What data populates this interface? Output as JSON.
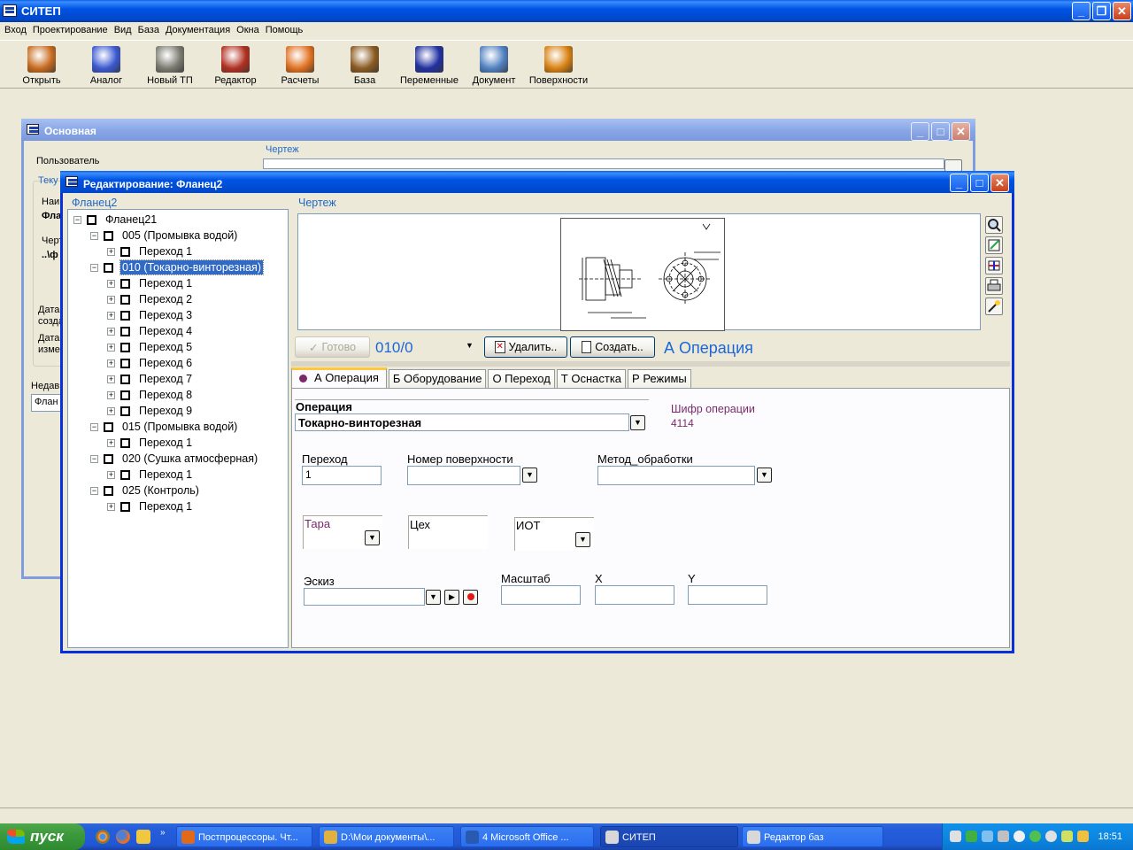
{
  "app": {
    "title": "СИТЕП",
    "menu": [
      "Вход",
      "Проектирование",
      "Вид",
      "База",
      "Документация",
      "Окна",
      "Помощь"
    ],
    "toolbar": [
      {
        "label": "Открыть",
        "icon": "open-folder-icon",
        "color": "#c86a1e"
      },
      {
        "label": "Аналог",
        "icon": "analog-gears-icon",
        "color": "#3a58d0"
      },
      {
        "label": "Новый ТП",
        "icon": "compass-icon",
        "color": "#7a7a70"
      },
      {
        "label": "Редактор",
        "icon": "editor-pencil-icon",
        "color": "#b03020"
      },
      {
        "label": "Расчеты",
        "icon": "calculator-icon",
        "color": "#e07020"
      },
      {
        "label": "База",
        "icon": "database-box-icon",
        "color": "#8a5a20"
      },
      {
        "label": "Переменные",
        "icon": "function-fx-icon",
        "color": "#2030a0"
      },
      {
        "label": "Документ",
        "icon": "document-icon",
        "color": "#5080c0"
      },
      {
        "label": "Поверхности",
        "icon": "surfaces-gear-icon",
        "color": "#d88010"
      }
    ]
  },
  "main_window": {
    "title": "Основная",
    "user_label": "Пользователь",
    "drawing_label": "Чертеж",
    "current_label": "Теку",
    "name_label": "Наим",
    "name_value": "Фла",
    "drawing_label2": "Черт",
    "drawing_value": "..\\ф",
    "created_label": "Дата созда",
    "modified_label": "Дата изме",
    "recent_label": "Недав",
    "recent_value": "Флан"
  },
  "edit_window": {
    "title": "Редактирование: Фланец2",
    "tree_group_label": "Фланец2",
    "drawing_group_label": "Чертеж",
    "tree": [
      {
        "label": "Фланец21",
        "level": 0,
        "expander": "−"
      },
      {
        "label": "005 (Промывка водой)",
        "level": 1,
        "expander": "−"
      },
      {
        "label": "Переход 1",
        "level": 2,
        "expander": "+"
      },
      {
        "label": "010 (Токарно-винторезная)",
        "level": 1,
        "expander": "−",
        "selected": true
      },
      {
        "label": "Переход 1",
        "level": 2,
        "expander": "+"
      },
      {
        "label": "Переход 2",
        "level": 2,
        "expander": "+"
      },
      {
        "label": "Переход 3",
        "level": 2,
        "expander": "+"
      },
      {
        "label": "Переход 4",
        "level": 2,
        "expander": "+"
      },
      {
        "label": "Переход 5",
        "level": 2,
        "expander": "+"
      },
      {
        "label": "Переход 6",
        "level": 2,
        "expander": "+"
      },
      {
        "label": "Переход 7",
        "level": 2,
        "expander": "+"
      },
      {
        "label": "Переход 8",
        "level": 2,
        "expander": "+"
      },
      {
        "label": "Переход 9",
        "level": 2,
        "expander": "+"
      },
      {
        "label": "015 (Промывка водой)",
        "level": 1,
        "expander": "−"
      },
      {
        "label": "Переход 1",
        "level": 2,
        "expander": "+"
      },
      {
        "label": "020 (Сушка атмосферная)",
        "level": 1,
        "expander": "−"
      },
      {
        "label": "Переход 1",
        "level": 2,
        "expander": "+"
      },
      {
        "label": "025 (Контроль)",
        "level": 1,
        "expander": "−"
      },
      {
        "label": "Переход 1",
        "level": 2,
        "expander": "+"
      }
    ],
    "ready_button": "Готово",
    "operation_code": "010/0",
    "delete_button": "Удалить..",
    "create_button": "Создать..",
    "section_title": "А Операция",
    "tabs": [
      "А Операция",
      "Б Оборудование",
      "О Переход",
      "Т Оснастка",
      "Р Режимы"
    ],
    "form": {
      "operation_label": "Операция",
      "operation_value": "Токарно-винторезная",
      "cipher_label": "Шифр операции",
      "cipher_value": "4114",
      "transition_label": "Переход",
      "transition_value": "1",
      "surface_label": "Номер поверхности",
      "surface_value": "",
      "method_label": "Метод_обработки",
      "method_value": "",
      "tara_label": "Тара",
      "shop_label": "Цех",
      "iot_label": "ИОТ",
      "sketch_label": "Эскиз",
      "scale_label": "Масштаб",
      "x_label": "X",
      "y_label": "Y"
    }
  },
  "taskbar": {
    "start_label": "пуск",
    "tasks": [
      {
        "label": "Постпроцессоры. Чт...",
        "color": "#e06a1a",
        "active": false
      },
      {
        "label": "D:\\Мои документы\\...",
        "color": "#e0b040",
        "active": false
      },
      {
        "label": "4 Microsoft Office ...",
        "color": "#2a5ab0",
        "active": false
      },
      {
        "label": "СИТЕП",
        "color": "#d8d8d8",
        "active": true
      },
      {
        "label": "Редактор баз",
        "color": "#d8d8d8",
        "active": false
      }
    ],
    "clock": "18:51"
  }
}
